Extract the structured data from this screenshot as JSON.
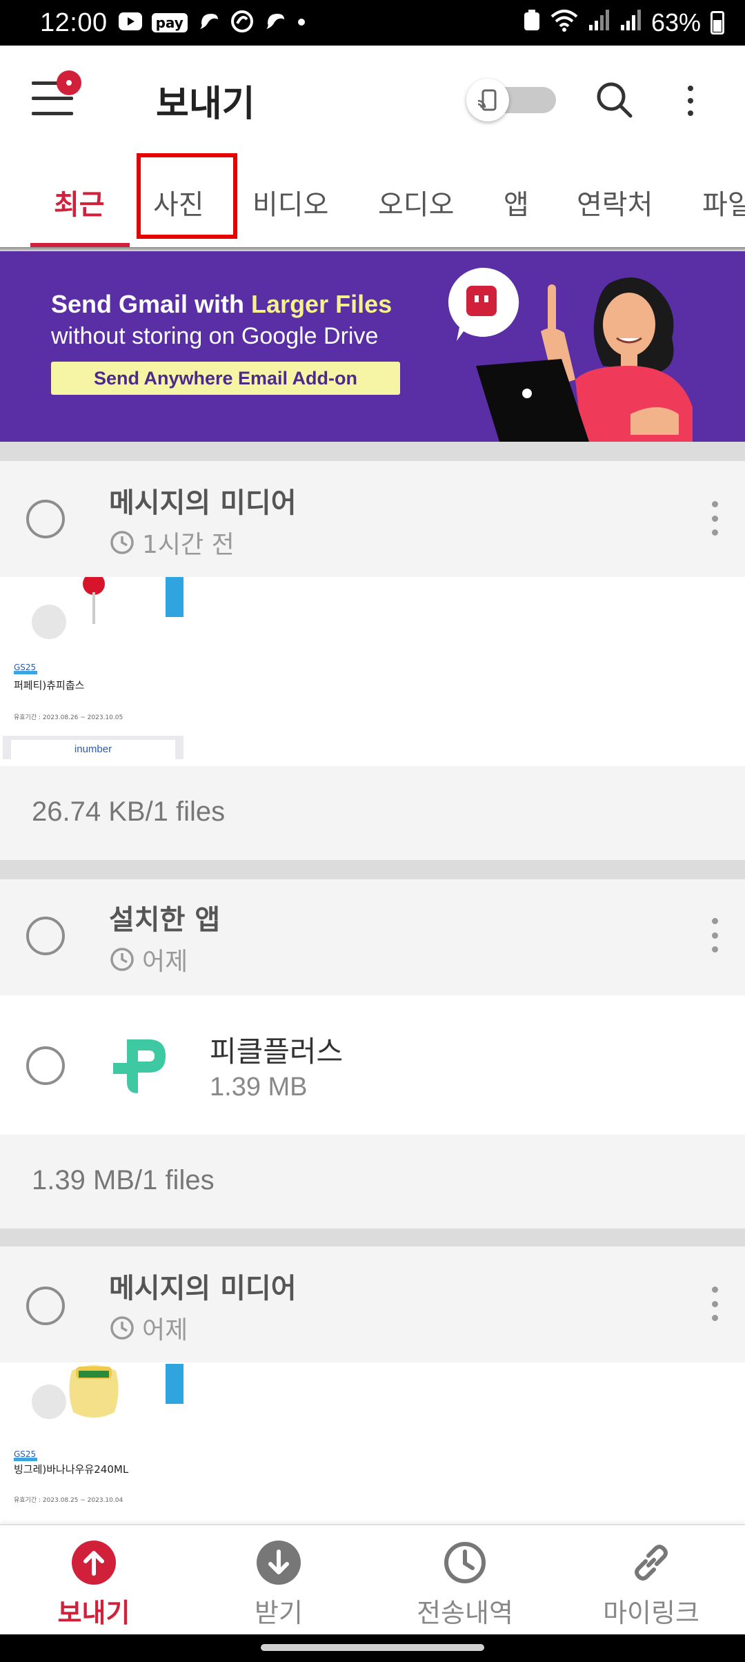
{
  "status_bar": {
    "time": "12:00",
    "pay_chip": "pay",
    "battery": "63%"
  },
  "app_bar": {
    "title": "보내기"
  },
  "tabs": [
    {
      "label": "최근",
      "active": true
    },
    {
      "label": "사진",
      "active": false
    },
    {
      "label": "비디오",
      "active": false
    },
    {
      "label": "오디오",
      "active": false
    },
    {
      "label": "앱",
      "active": false
    },
    {
      "label": "연락처",
      "active": false
    },
    {
      "label": "파일",
      "active": false
    }
  ],
  "banner": {
    "line1_a": "Send Gmail with ",
    "line1_b": "Larger Files",
    "line2": "without storing on Google Drive",
    "cta": "Send Anywhere Email Add-on"
  },
  "groups": [
    {
      "title": "메시지의 미디어",
      "time": "1시간 전",
      "thumb": {
        "tag": "GS25",
        "name": "퍼페티)츄피춥스",
        "period": "유효기간 : 2023.08.26 ~ 2023.10.05",
        "footer": "inumber"
      },
      "summary": "26.74 KB/1 files"
    },
    {
      "title": "설치한 앱",
      "time": "어제",
      "app": {
        "name": "피클플러스",
        "size": "1.39 MB"
      },
      "summary": "1.39 MB/1 files"
    },
    {
      "title": "메시지의 미디어",
      "time": "어제",
      "thumb": {
        "tag": "GS25",
        "name": "빙그레)바나나우유240ML",
        "period": "유효기간 : 2023.08.25 ~ 2023.10.04"
      }
    }
  ],
  "bottom_nav": [
    {
      "label": "보내기",
      "icon": "upload-icon",
      "active": true
    },
    {
      "label": "받기",
      "icon": "download-icon",
      "active": false
    },
    {
      "label": "전송내역",
      "icon": "history-clock-icon",
      "active": false
    },
    {
      "label": "마이링크",
      "icon": "link-icon",
      "active": false
    }
  ],
  "colors": {
    "accent": "#d1213a",
    "banner_bg": "#5a2fa6",
    "banner_highlight": "#f6f28a",
    "highlight_box": "#e60000"
  }
}
